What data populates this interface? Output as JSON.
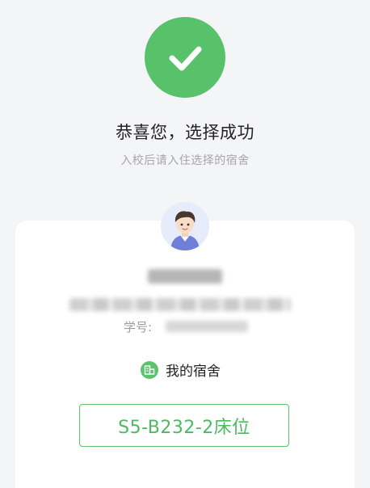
{
  "success": {
    "title": "恭喜您，选择成功",
    "subtitle": "入校后请入住选择的宿舍"
  },
  "profile": {
    "student_id_label": "学号:"
  },
  "dorm": {
    "label": "我的宿舍",
    "bed": "S5-B232-2床位"
  },
  "colors": {
    "accent": "#58c26b",
    "background": "#f4f5f7"
  },
  "icons": {
    "success": "checkmark-icon",
    "dorm": "building-icon"
  }
}
